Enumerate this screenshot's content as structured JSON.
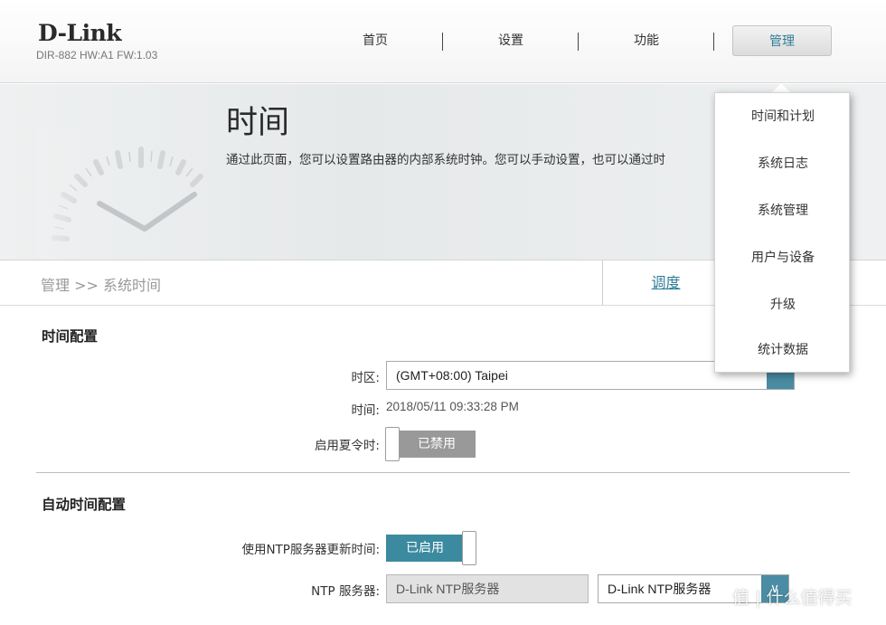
{
  "brand": {
    "logo": "D-Link",
    "hw_info": "DIR-882 HW:A1 FW:1.03"
  },
  "nav": {
    "items": [
      {
        "label": "首页"
      },
      {
        "label": "设置"
      },
      {
        "label": "功能"
      },
      {
        "label": "管理"
      }
    ],
    "active": "管理"
  },
  "page": {
    "title": "时间",
    "description": "通过此页面，您可以设置路由器的内部系统时钟。您可以手动设置，也可以通过时"
  },
  "breadcrumb": "管理 >> 系统时间",
  "tabs": {
    "schedule": "调度"
  },
  "time_config": {
    "title": "时间配置",
    "timezone_label": "时区:",
    "timezone_value": "(GMT+08:00) Taipei",
    "time_label": "时间:",
    "time_value": "2018/05/11 09:33:28 PM",
    "dst_label": "启用夏令时:",
    "dst_state": "已禁用"
  },
  "auto_time": {
    "title": "自动时间配置",
    "ntp_update_label": "使用NTP服务器更新时间:",
    "ntp_update_state": "已启用",
    "ntp_server_label": "NTP 服务器:",
    "ntp_server_field": "D-Link NTP服务器",
    "ntp_server_select": "D-Link NTP服务器"
  },
  "dropdown_menu": {
    "items": [
      {
        "label": "时间和计划"
      },
      {
        "label": "系统日志"
      },
      {
        "label": "系统管理"
      },
      {
        "label": "用户与设备"
      },
      {
        "label": "升级"
      },
      {
        "label": "统计数据"
      }
    ]
  },
  "watermark": "值 | 什么值得买",
  "colors": {
    "accent": "#2f7e98",
    "toggle_enabled": "#3b8aa0",
    "toggle_disabled": "#999999",
    "select_arrow": "#4a8ca3"
  },
  "icons": {
    "clock": "clock-icon",
    "select_arrow": "chevron-down-icon"
  }
}
